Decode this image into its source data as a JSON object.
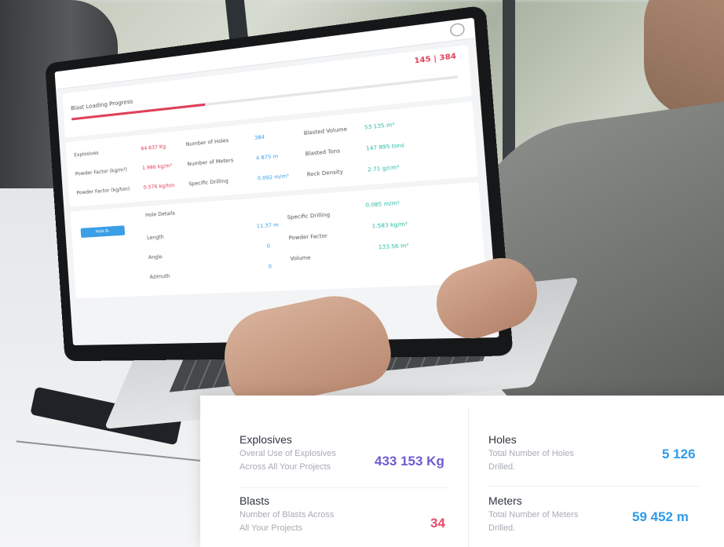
{
  "screen": {
    "progress_label": "Blast Loading Progress",
    "progress_count": "145 | 384",
    "progress_fraction": 0.38,
    "metrics": [
      {
        "label": "Explosives",
        "value": "84 837 Kg"
      },
      {
        "label": "Powder Factor (kg/m³)",
        "value": "1.986 kg/m³"
      },
      {
        "label": "Powder Factor (kg/ton)",
        "value": "0.576 kg/ton"
      },
      {
        "label": "Number of Holes",
        "value": "384"
      },
      {
        "label": "Number of Meters",
        "value": "4 875 m"
      },
      {
        "label": "Specific Drilling",
        "value": "0.092 m/m³"
      },
      {
        "label": "Blasted Volume",
        "value": "53 135 m³"
      },
      {
        "label": "Blasted Tons",
        "value": "147 895 tons"
      },
      {
        "label": "Rock Density",
        "value": "2.71 g/cm³"
      }
    ],
    "hole_button": "Hole B-",
    "hole_details_title": "Hole Details",
    "hole_details": [
      {
        "label": "Length",
        "value": "11.37 m"
      },
      {
        "label": "Angle",
        "value": "0"
      },
      {
        "label": "Azimuth",
        "value": "0"
      }
    ],
    "hole_details_right": [
      {
        "label": "Specific Drilling",
        "value": "0.085 m/m³"
      },
      {
        "label": "Powder Factor",
        "value": "1.583 kg/m³"
      },
      {
        "label": "Volume",
        "value": "133.56 m³"
      }
    ]
  },
  "stats": {
    "explosives": {
      "title": "Explosives",
      "desc": "Overal Use of Explosives Across All Your Projects",
      "value": "433 153 Kg",
      "color": "#6f5bd3"
    },
    "blasts": {
      "title": "Blasts",
      "desc": "Number of Blasts Across All Your Projects",
      "value": "34",
      "color": "#ea4b6a"
    },
    "holes": {
      "title": "Holes",
      "desc": "Total Number of Holes Drilled.",
      "value": "5 126",
      "color": "#2f9be8"
    },
    "meters": {
      "title": "Meters",
      "desc": "Total Number of Meters Drilled.",
      "value": "59 452 m",
      "color": "#2f9be8"
    }
  }
}
